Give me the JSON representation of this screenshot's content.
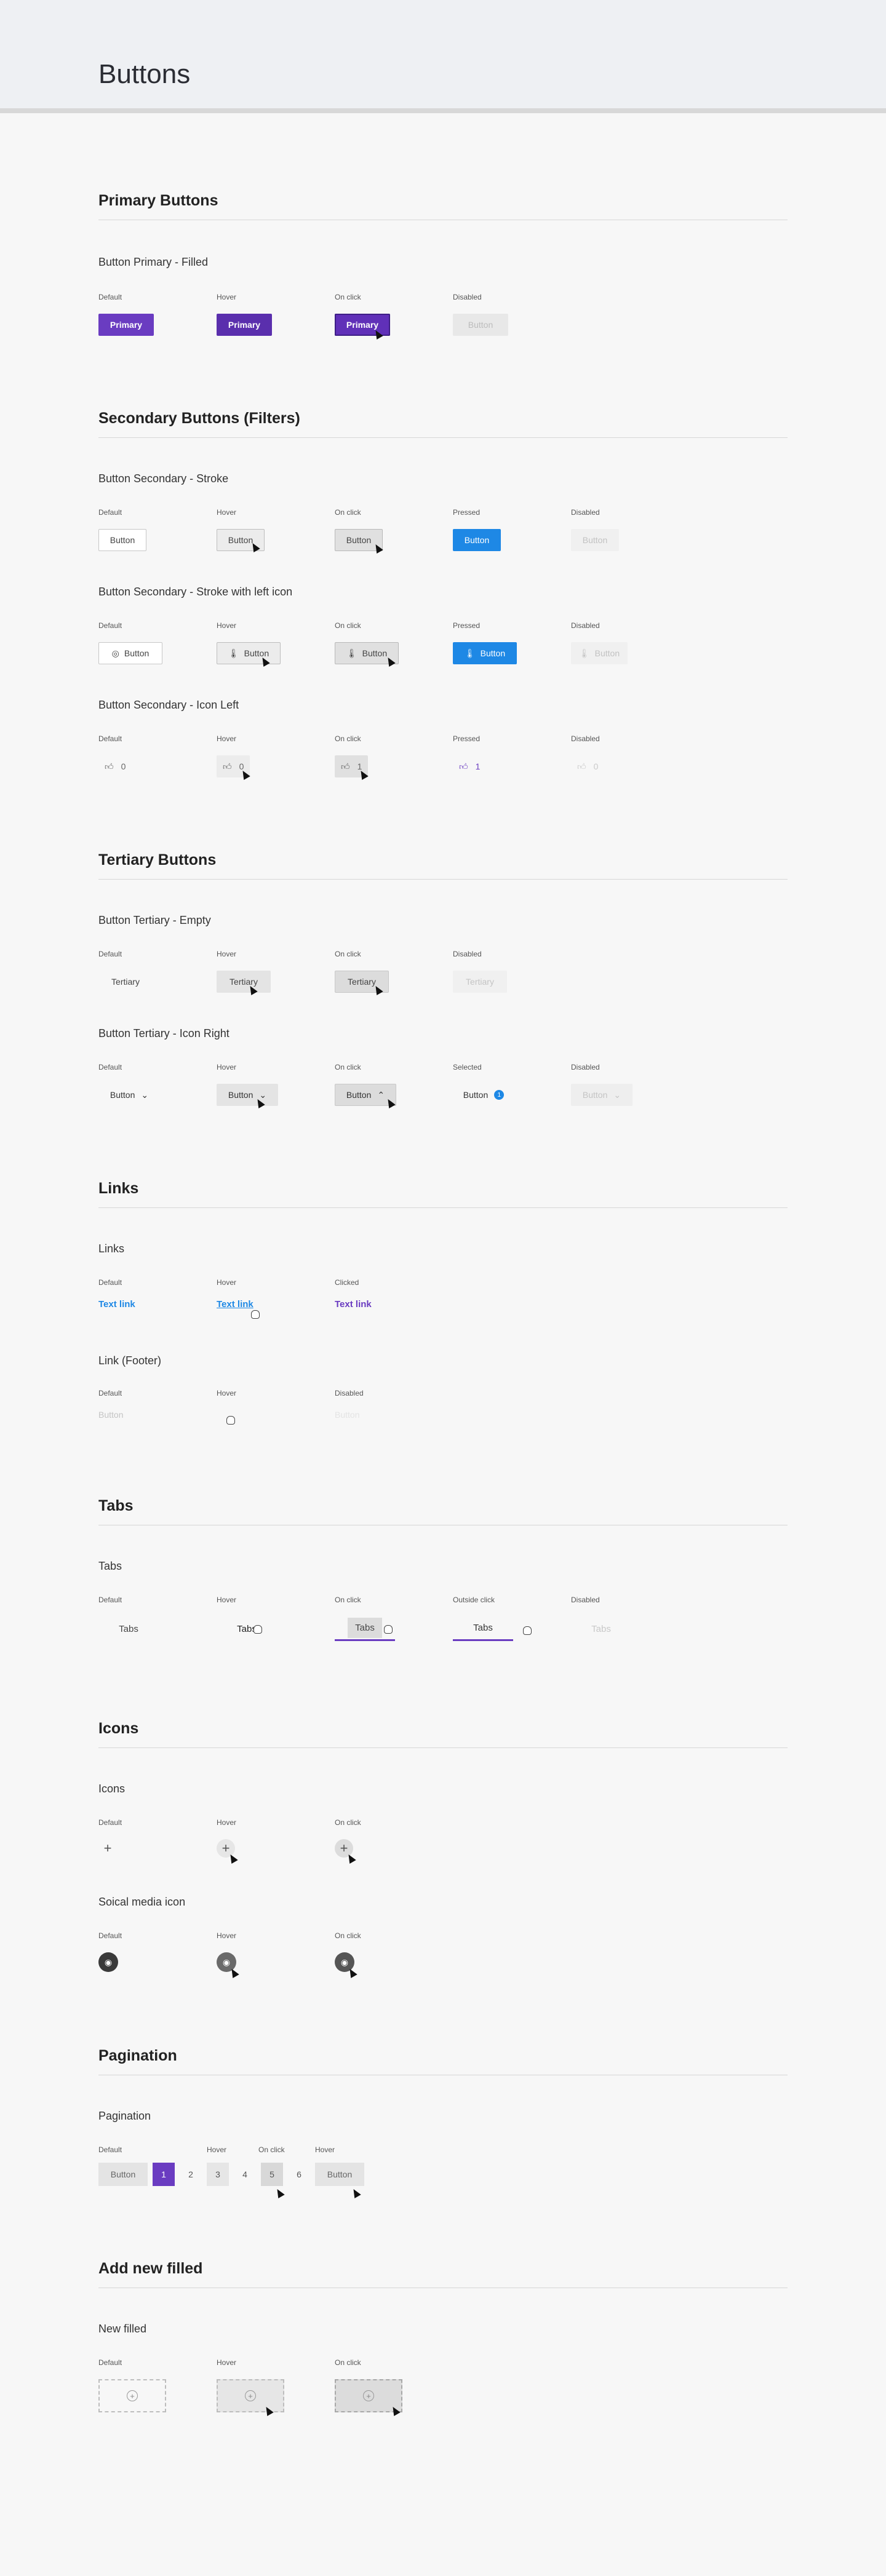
{
  "page": {
    "title": "Buttons"
  },
  "states": {
    "default": "Default",
    "hover": "Hover",
    "on_click": "On click",
    "pressed": "Pressed",
    "disabled": "Disabled",
    "selected": "Selected",
    "clicked": "Clicked",
    "outside_click": "Outside click"
  },
  "primary": {
    "section": "Primary Buttons",
    "group": "Button Primary - Filled",
    "label": "Primary",
    "disabled_label": "Button"
  },
  "secondary": {
    "section": "Secondary Buttons (Filters)",
    "group_stroke": "Button Secondary - Stroke",
    "group_stroke_icon": "Button Secondary - Stroke with left icon",
    "group_icon_left": "Button Secondary - Icon Left",
    "label": "Button",
    "count_default": "0",
    "count_pressed": "1"
  },
  "tertiary": {
    "section": "Tertiary Buttons",
    "group_empty": "Button Tertiary - Empty",
    "group_icon_right": "Button Tertiary - Icon Right",
    "label": "Tertiary",
    "button_label": "Button",
    "badge": "1"
  },
  "links": {
    "section": "Links",
    "group": "Links",
    "group_footer": "Link (Footer)",
    "text": "Text link",
    "footer_text": "Button"
  },
  "tabs": {
    "section": "Tabs",
    "group": "Tabs",
    "label": "Tabs"
  },
  "icons": {
    "section": "Icons",
    "group": "Icons",
    "group_social": "Soical media icon"
  },
  "pagination": {
    "section": "Pagination",
    "group": "Pagination",
    "button_label": "Button",
    "pages": [
      "1",
      "2",
      "3",
      "4",
      "5",
      "6"
    ]
  },
  "add_new": {
    "section": "Add new filled",
    "group": "New filled"
  },
  "colors": {
    "accent": "#6a3cc1",
    "pressed_blue": "#1e88e5",
    "background": "#f7f7f7"
  }
}
